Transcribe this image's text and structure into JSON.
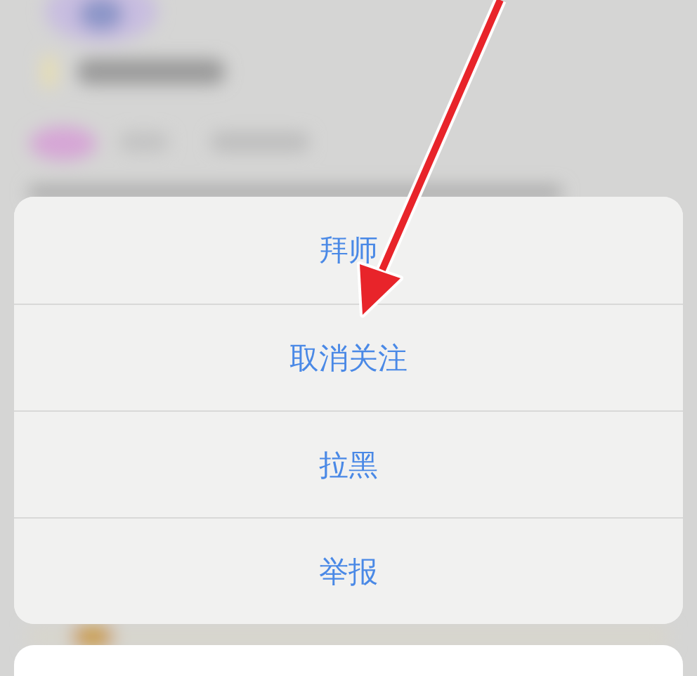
{
  "action_sheet": {
    "actions": [
      {
        "label": "拜师"
      },
      {
        "label": "取消关注"
      },
      {
        "label": "拉黑"
      },
      {
        "label": "举报"
      }
    ]
  }
}
